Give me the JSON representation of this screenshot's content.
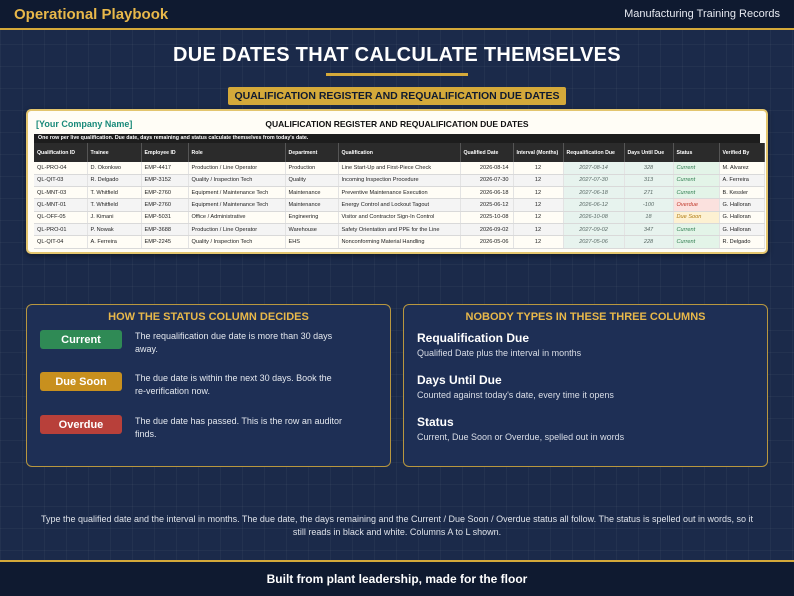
{
  "header": {
    "brand": "Operational Playbook",
    "right_label": "Manufacturing Training Records"
  },
  "headline": "DUE DATES THAT CALCULATE THEMSELVES",
  "pill_label": "QUALIFICATION REGISTER AND REQUALIFICATION DUE DATES",
  "sheet": {
    "company": "[Your Company Name]",
    "title": "QUALIFICATION REGISTER AND REQUALIFICATION DUE DATES",
    "note": "One row per live qualification. Due date, days remaining and status calculate themselves from today's date.",
    "columns": [
      "Qualification ID",
      "Trainee",
      "Employee ID",
      "Role",
      "Department",
      "Qualification",
      "Qualified Date",
      "Interval (Months)",
      "Requalification Due",
      "Days Until Due",
      "Status",
      "Verified By"
    ],
    "rows": [
      [
        "QL-PRO-04",
        "D. Okonkwo",
        "EMP-4417",
        "Production / Line Operator",
        "Production",
        "Line Start-Up and First-Piece Check",
        "2026-08-14",
        "12",
        "2027-08-14",
        "328",
        "Current",
        "M. Alvarez"
      ],
      [
        "QL-QIT-03",
        "R. Delgado",
        "EMP-3152",
        "Quality / Inspection Tech",
        "Quality",
        "Incoming Inspection Procedure",
        "2026-07-30",
        "12",
        "2027-07-30",
        "313",
        "Current",
        "A. Ferreira"
      ],
      [
        "QL-MNT-03",
        "T. Whitfield",
        "EMP-2760",
        "Equipment / Maintenance Tech",
        "Maintenance",
        "Preventive Maintenance Execution",
        "2026-06-18",
        "12",
        "2027-06-18",
        "271",
        "Current",
        "B. Kessler"
      ],
      [
        "QL-MNT-01",
        "T. Whitfield",
        "EMP-2760",
        "Equipment / Maintenance Tech",
        "Maintenance",
        "Energy Control and Lockout Tagout",
        "2025-06-12",
        "12",
        "2026-06-12",
        "-100",
        "Overdue",
        "G. Halloran"
      ],
      [
        "QL-OFF-05",
        "J. Kimani",
        "EMP-5031",
        "Office / Administrative",
        "Engineering",
        "Visitor and Contractor Sign-In Control",
        "2025-10-08",
        "12",
        "2026-10-08",
        "18",
        "Due Soon",
        "G. Halloran"
      ],
      [
        "QL-PRO-01",
        "P. Nowak",
        "EMP-3688",
        "Production / Line Operator",
        "Warehouse",
        "Safety Orientation and PPE for the Line",
        "2026-09-02",
        "12",
        "2027-09-02",
        "347",
        "Current",
        "G. Halloran"
      ],
      [
        "QL-QIT-04",
        "A. Ferreira",
        "EMP-2245",
        "Quality / Inspection Tech",
        "EHS",
        "Nonconforming Material Handling",
        "2026-05-06",
        "12",
        "2027-05-06",
        "228",
        "Current",
        "R. Delgado"
      ]
    ]
  },
  "status_panel": {
    "title": "HOW THE STATUS COLUMN DECIDES",
    "items": [
      {
        "label": "Current",
        "desc": "The requalification due date is more than 30 days away."
      },
      {
        "label": "Due Soon",
        "desc": "The due date is within the next 30 days. Book the re-verification now."
      },
      {
        "label": "Overdue",
        "desc": "The due date has passed. This is the row an auditor finds."
      }
    ],
    "colors": {
      "current": "#2f8a55",
      "soon": "#c8901e",
      "overdue": "#b8403a"
    }
  },
  "columns_panel": {
    "title": "NOBODY TYPES IN THESE THREE COLUMNS",
    "items": [
      {
        "name": "Requalification Due",
        "desc": "Qualified Date plus the interval in months"
      },
      {
        "name": "Days Until Due",
        "desc": "Counted against today's date, every time it opens"
      },
      {
        "name": "Status",
        "desc": "Current, Due Soon or Overdue, spelled out in words"
      }
    ]
  },
  "footnote": "Type the qualified date and the interval in months. The due date, the days remaining and the Current / Due Soon / Overdue status all follow. The status is spelled out in words, so it still reads in black and white. Columns A to L shown.",
  "footer": "Built from plant leadership, made for the floor"
}
